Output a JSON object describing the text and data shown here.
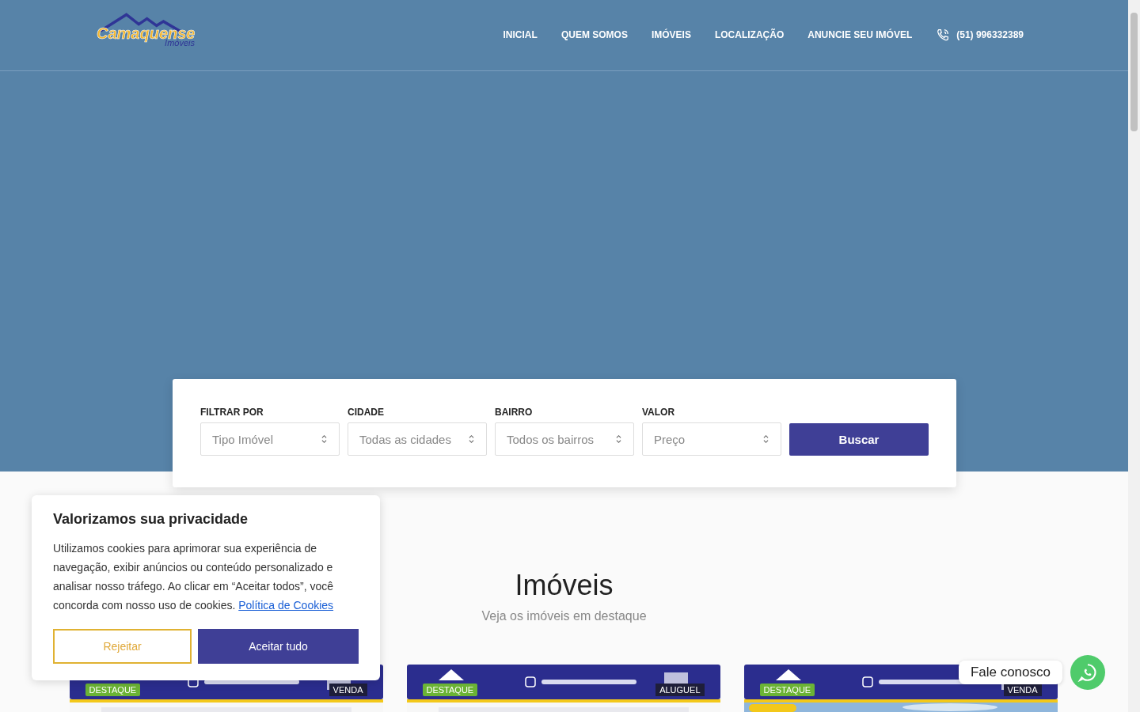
{
  "header": {
    "logo": {
      "name": "Camaquense",
      "subtitle": "Imóveis"
    },
    "nav": [
      {
        "label": "INICIAL"
      },
      {
        "label": "QUEM SOMOS"
      },
      {
        "label": "IMÓVEIS"
      },
      {
        "label": "LOCALIZAÇÃO"
      },
      {
        "label": "ANUNCIE SEU IMÓVEL"
      }
    ],
    "phone": "(51) 996332389"
  },
  "search": {
    "fields": [
      {
        "label": "FILTRAR POR",
        "placeholder": "Tipo Imóvel"
      },
      {
        "label": "CIDADE",
        "placeholder": "Todas as cidades"
      },
      {
        "label": "BAIRRO",
        "placeholder": "Todos os bairros"
      },
      {
        "label": "VALOR",
        "placeholder": "Preço"
      }
    ],
    "button": "Buscar"
  },
  "section": {
    "title": "Imóveis",
    "subtitle": "Veja os imóveis em destaque"
  },
  "listings": [
    {
      "featured": "DESTAQUE",
      "deal": "VENDA",
      "kind": "banner"
    },
    {
      "featured": "DESTAQUE",
      "deal": "ALUGUEL",
      "kind": "banner"
    },
    {
      "featured": "DESTAQUE",
      "deal": "VENDA"
    }
  ],
  "cookie_notice": {
    "title": "Valorizamos sua privacidade",
    "text": "Utilizamos cookies para aprimorar sua experiência de navegação, exibir anúncios ou conteúdo personalizado e analisar nosso tráfego. Ao clicar em “Aceitar todos”, você concorda com nosso uso de cookies.",
    "link": "Política de Cookies",
    "reject": "Rejeitar",
    "accept": "Aceitar tudo"
  },
  "chat": {
    "label": "Fale conosco"
  }
}
